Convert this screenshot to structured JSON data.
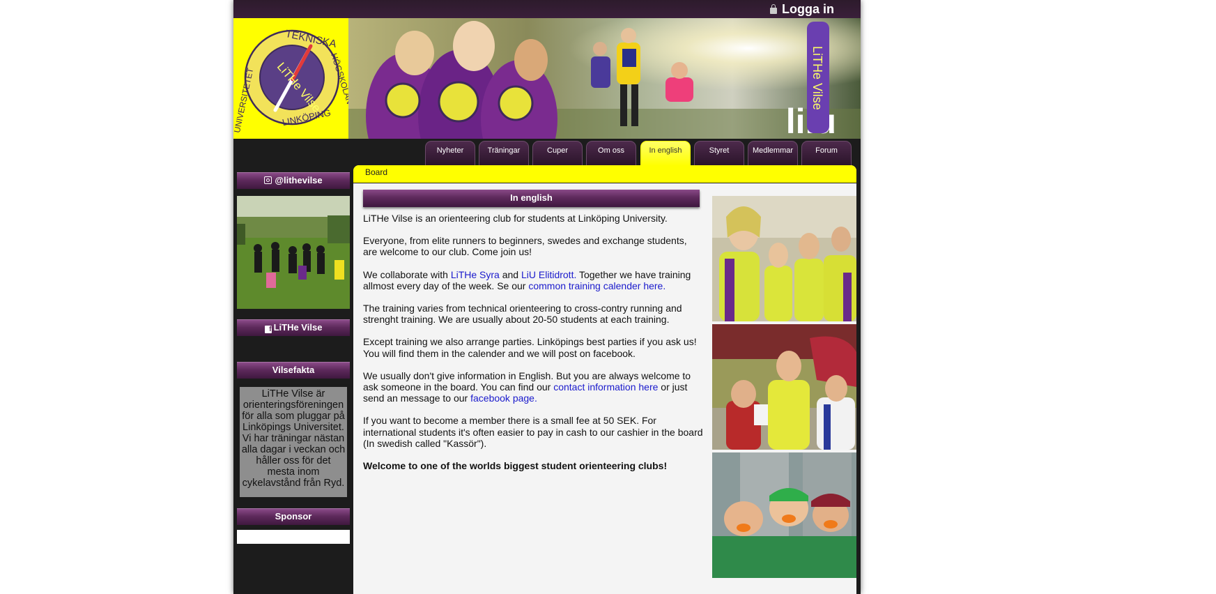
{
  "header": {
    "login_label": "Logga in"
  },
  "banner": {
    "logo_ring_text": [
      "TEKNISKA",
      "HÖGSKOLAN",
      "LINKÖPING",
      "UNIVERSITETET"
    ],
    "logo_center_text": "LiTHe Vilse",
    "liu_logo_text": "li.u",
    "flag_text": "LiTHe Vilse"
  },
  "nav": {
    "tabs": [
      {
        "label": "Nyheter"
      },
      {
        "label": "Träningar"
      },
      {
        "label": "Cuper"
      },
      {
        "label": "Om oss"
      },
      {
        "label": "In english"
      },
      {
        "label": "Styret"
      },
      {
        "label": "Medlemmar"
      },
      {
        "label": "Forum"
      }
    ],
    "active": "In english"
  },
  "sidebar": {
    "instagram_title": "@lithevilse",
    "facebook_title": "LiTHe Vilse",
    "vilsefakta_title": "Vilsefakta",
    "vilsefakta_text": "LiTHe Vilse är orienteringsföreningen för alla som pluggar på Linköpings Universitet. Vi har träningar nästan alla dagar i veckan och håller oss för det mesta inom cykelavstånd från Ryd.",
    "sponsor_title": "Sponsor"
  },
  "breadcrumb": {
    "label": "Board"
  },
  "content": {
    "heading": "In english",
    "p1": "LiTHe Vilse is an orienteering club for students at Linköping University.",
    "p2": "Everyone, from elite runners to beginners, swedes and exchange students, are welcome to our club. Come join us!",
    "p3_a": "We collaborate with ",
    "p3_link1": "LiTHe Syra",
    "p3_b": " and ",
    "p3_link2": "LiU Elitidrott.",
    "p3_c": " Together we have training allmost every day of the week. Se our ",
    "p3_link3": "common training calender here.",
    "p4": "The training varies from technical orienteering to cross-contry running and strenght training. We are usually about 20-50 students at each training.",
    "p5": "Except training we also arrange parties. Linköpings best parties if you ask us! You will find them in the calender and we will post on facebook.",
    "p6_a": "We usually don't give information in English. But you are always welcome to ask someone in the board. You can find our ",
    "p6_link1": "contact information here",
    "p6_b": " or just send an message to our ",
    "p6_link2": "facebook page.",
    "p7": "If you want to become a member there is a small fee at 50 SEK. For international students it's often easier to pay in cash to our cashier in the board (In swedish called \"Kassör\").",
    "p8": "Welcome to one of the worlds biggest student orienteering clubs!"
  },
  "colors": {
    "brand_purple": "#5e2a5c",
    "brand_yellow": "#ffff00",
    "page_dark": "#1c1c1c",
    "link_blue": "#1a1acc"
  }
}
